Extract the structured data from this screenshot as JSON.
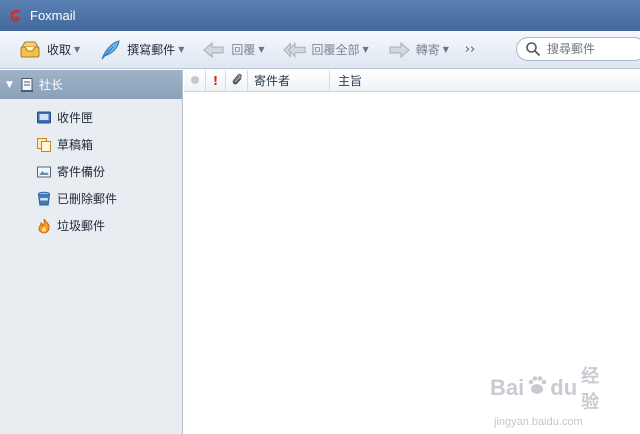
{
  "window": {
    "title": "Foxmail"
  },
  "toolbar": {
    "receive_label": "收取",
    "compose_label": "撰寫郵件",
    "reply_label": "回覆",
    "reply_all_label": "回覆全部",
    "forward_label": "轉寄",
    "more_label": "››",
    "search_placeholder": "搜尋郵件"
  },
  "sidebar": {
    "account": "社长",
    "folders": [
      {
        "label": "收件匣",
        "icon": "inbox-icon"
      },
      {
        "label": "草稿箱",
        "icon": "drafts-icon"
      },
      {
        "label": "寄件備份",
        "icon": "sent-icon"
      },
      {
        "label": "已刪除郵件",
        "icon": "trash-icon"
      },
      {
        "label": "垃圾郵件",
        "icon": "junk-icon"
      }
    ]
  },
  "mail_list": {
    "columns": {
      "flag": "!",
      "from": "寄件者",
      "subject": "主旨"
    }
  },
  "watermark": {
    "brand": "Bai",
    "brand2": "du",
    "cn": "经验",
    "url": "jingyan.baidu.com"
  },
  "colors": {
    "titlebar": "#4d72a6",
    "accent_red": "#d9261c",
    "sidebar_bg": "#e9edf2"
  }
}
